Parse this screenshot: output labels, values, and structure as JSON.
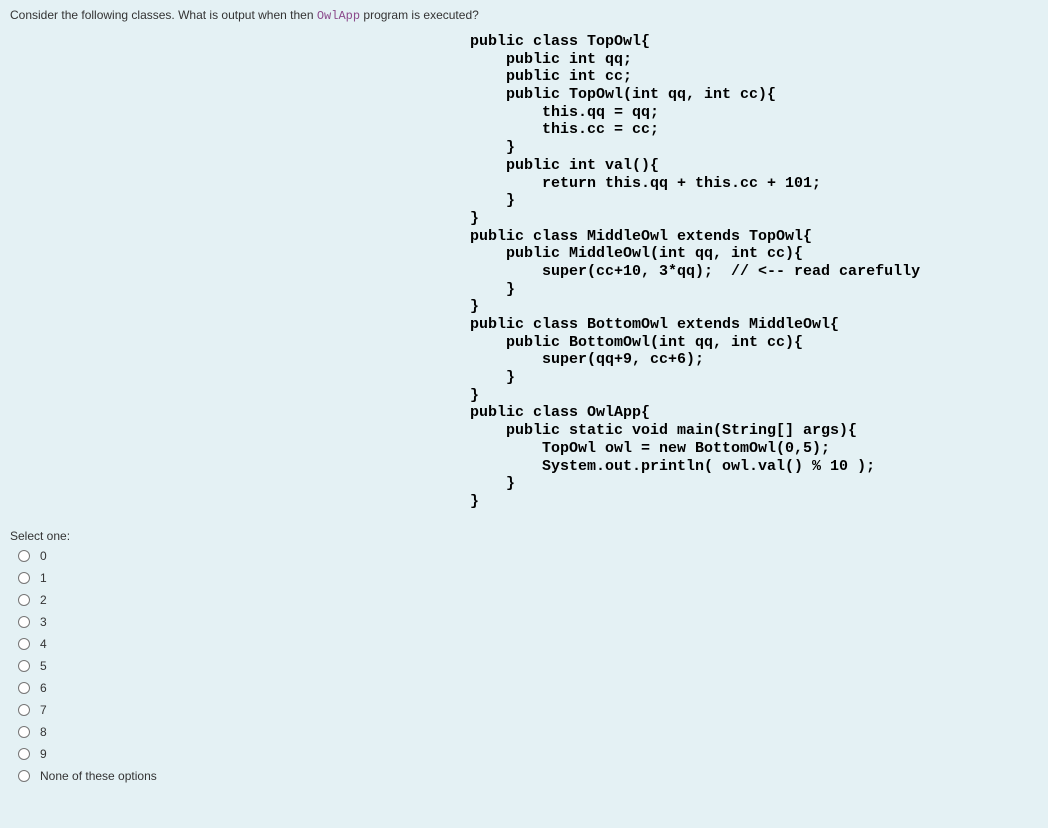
{
  "question": {
    "prefix": "Consider the following classes. What is output when then ",
    "code_word": "OwlApp",
    "suffix": " program is executed?"
  },
  "code": "public class TopOwl{\n    public int qq;\n    public int cc;\n    public TopOwl(int qq, int cc){\n        this.qq = qq;\n        this.cc = cc;\n    }\n    public int val(){\n        return this.qq + this.cc + 101;\n    }\n}\npublic class MiddleOwl extends TopOwl{\n    public MiddleOwl(int qq, int cc){\n        super(cc+10, 3*qq);  // <-- read carefully\n    }\n}\npublic class BottomOwl extends MiddleOwl{\n    public BottomOwl(int qq, int cc){\n        super(qq+9, cc+6);\n    }\n}\npublic class OwlApp{\n    public static void main(String[] args){\n        TopOwl owl = new BottomOwl(0,5);\n        System.out.println( owl.val() % 10 );\n    }\n}",
  "select_label": "Select one:",
  "options": [
    {
      "label": "0"
    },
    {
      "label": "1"
    },
    {
      "label": "2"
    },
    {
      "label": "3"
    },
    {
      "label": "4"
    },
    {
      "label": "5"
    },
    {
      "label": "6"
    },
    {
      "label": "7"
    },
    {
      "label": "8"
    },
    {
      "label": "9"
    },
    {
      "label": "None of these options"
    }
  ]
}
